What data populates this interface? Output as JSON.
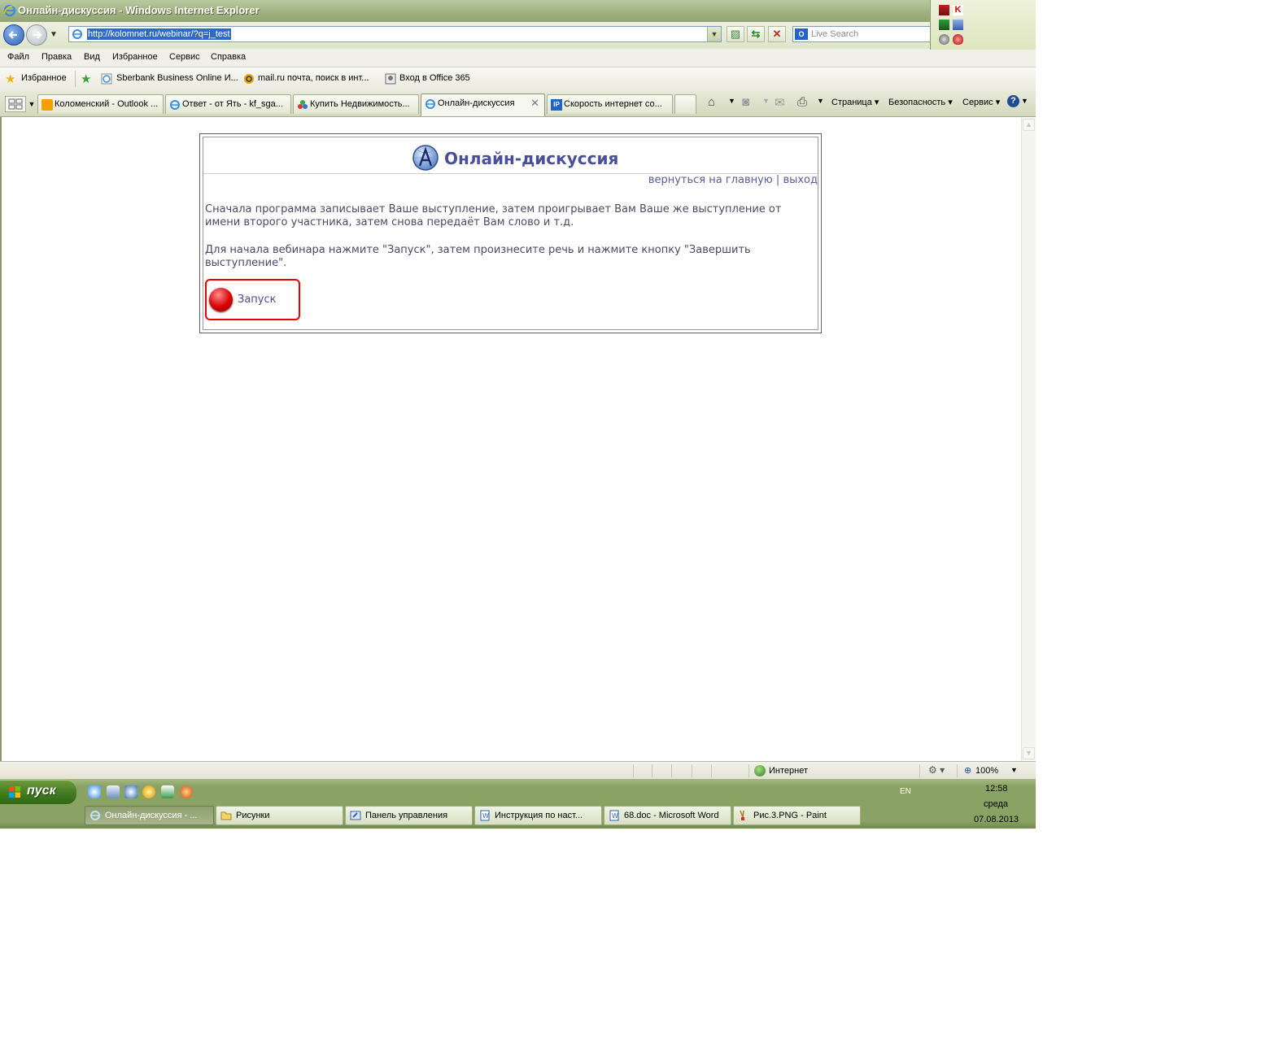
{
  "window": {
    "title": "Онлайн-дискуссия - Windows Internet Explorer"
  },
  "address_bar": {
    "url": "http://kolomnet.ru/webinar/?q=j_test",
    "search_placeholder": "Live Search"
  },
  "menu": [
    "Файл",
    "Правка",
    "Вид",
    "Избранное",
    "Сервис",
    "Справка"
  ],
  "favorites_bar": {
    "label": "Избранное",
    "items": [
      "Sberbank Business Online И...",
      "mail.ru почта, поиск в инт...",
      "Вход в Office 365"
    ]
  },
  "tabs": [
    {
      "label": "Коломенский - Outlook ...",
      "active": false
    },
    {
      "label": "Ответ - от Ять - kf_sga...",
      "active": false
    },
    {
      "label": "Купить Недвижимость...",
      "active": false
    },
    {
      "label": "Онлайн-дискуссия",
      "active": true
    },
    {
      "label": "Скорость интернет со...",
      "active": false
    }
  ],
  "command_bar": {
    "page": "Страница",
    "safety": "Безопасность",
    "tools": "Сервис"
  },
  "page": {
    "title": "Онлайн-дискуссия",
    "link_home": "вернуться на главную",
    "link_separator": "|",
    "link_exit": "выход",
    "paragraph_1": "Сначала программа записывает Ваше выступление, затем проигрывает Вам Ваше же выступление от имени второго участника, затем снова передаёт Вам слово и т.д.",
    "paragraph_2": "Для начала вебинара нажмите \"Запуск\", затем произнесите речь и нажмите кнопку \"Завершить выступление\".",
    "start_button": "Запуск"
  },
  "status_bar": {
    "zone": "Интернет",
    "zoom": "100%"
  },
  "taskbar": {
    "start": "пуск",
    "language": "EN",
    "tasks": [
      {
        "label": "Онлайн-дискуссия - ...",
        "active": true
      },
      {
        "label": "Рисунки",
        "active": false
      },
      {
        "label": "Панель управления",
        "active": false
      },
      {
        "label": "Инструкция по наст...",
        "active": false
      },
      {
        "label": "68.doc - Microsoft Word",
        "active": false
      },
      {
        "label": "Рис.3.PNG - Paint",
        "active": false
      }
    ],
    "clock": {
      "time": "12:58",
      "day": "среда",
      "date": "07.08.2013"
    }
  },
  "colors": {
    "title_link": "#4a4f9a",
    "start_border": "#e60000",
    "start_dot": "#d80000",
    "xp_olive": "#8aa263"
  }
}
